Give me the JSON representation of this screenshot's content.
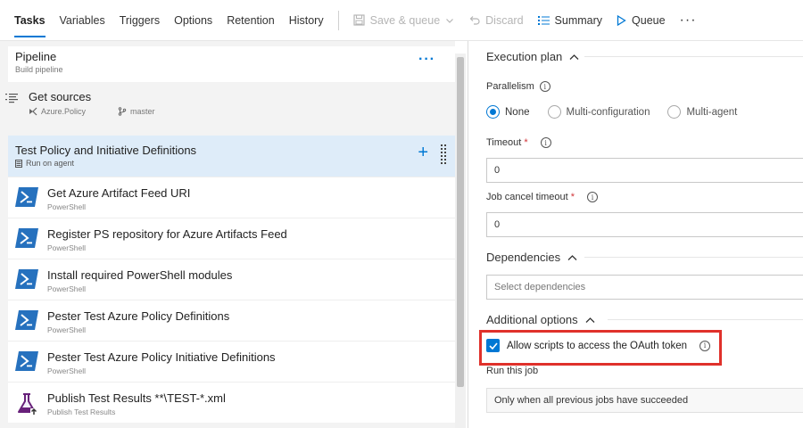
{
  "toolbar": {
    "tabs": [
      {
        "label": "Tasks",
        "active": true
      },
      {
        "label": "Variables"
      },
      {
        "label": "Triggers"
      },
      {
        "label": "Options"
      },
      {
        "label": "Retention"
      },
      {
        "label": "History"
      }
    ],
    "save_queue": "Save & queue",
    "discard": "Discard",
    "summary": "Summary",
    "queue": "Queue",
    "more": "···"
  },
  "pipeline": {
    "title": "Pipeline",
    "subtitle": "Build pipeline",
    "more": "···"
  },
  "get_sources": {
    "title": "Get sources",
    "repo": "Azure.Policy",
    "branch": "master"
  },
  "job": {
    "title": "Test Policy and Initiative Definitions",
    "subtitle": "Run on agent",
    "add": "+"
  },
  "tasks": [
    {
      "title": "Get Azure Artifact Feed URI",
      "subtitle": "PowerShell",
      "icon": "powershell-icon"
    },
    {
      "title": "Register PS repository for Azure Artifacts Feed",
      "subtitle": "PowerShell",
      "icon": "powershell-icon"
    },
    {
      "title": "Install required PowerShell modules",
      "subtitle": "PowerShell",
      "icon": "powershell-icon"
    },
    {
      "title": "Pester Test Azure Policy Definitions",
      "subtitle": "PowerShell",
      "icon": "powershell-icon"
    },
    {
      "title": "Pester Test Azure Policy Initiative Definitions",
      "subtitle": "PowerShell",
      "icon": "powershell-icon"
    },
    {
      "title": "Publish Test Results **\\TEST-*.xml",
      "subtitle": "Publish Test Results",
      "icon": "flask-icon"
    }
  ],
  "execution": {
    "heading": "Execution plan",
    "parallelism_label": "Parallelism",
    "options": [
      {
        "label": "None",
        "selected": true
      },
      {
        "label": "Multi-configuration",
        "selected": false
      },
      {
        "label": "Multi-agent",
        "selected": false
      }
    ],
    "timeout_label": "Timeout",
    "timeout_value": "0",
    "cancel_label": "Job cancel timeout",
    "cancel_value": "0",
    "required_mark": "*"
  },
  "dependencies": {
    "heading": "Dependencies",
    "placeholder": "Select dependencies"
  },
  "additional": {
    "heading": "Additional options",
    "oauth_label": "Allow scripts to access the OAuth token",
    "oauth_checked": true,
    "run_label": "Run this job",
    "run_value": "Only when all previous jobs have succeeded"
  },
  "colors": {
    "accent": "#0078d4",
    "highlight": "#e0312b",
    "job_bg": "#deecf9"
  }
}
